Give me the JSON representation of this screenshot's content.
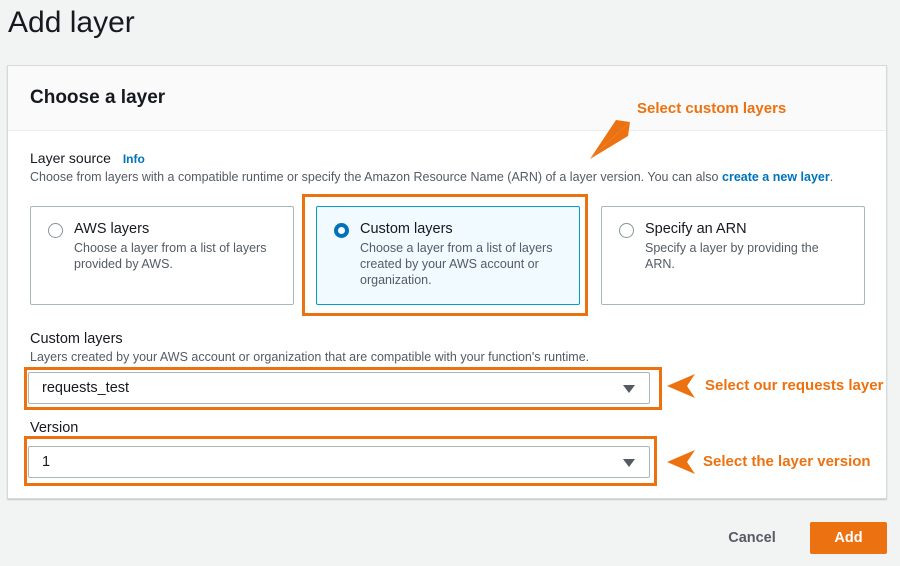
{
  "page": {
    "title": "Add layer"
  },
  "panel": {
    "title": "Choose a layer"
  },
  "layer_source": {
    "label": "Layer source",
    "info_link": "Info",
    "description": "Choose from layers with a compatible runtime or specify the Amazon Resource Name (ARN) of a layer version. You can also",
    "create_link": "create a new layer",
    "description_end": ".",
    "options": [
      {
        "title": "AWS layers",
        "description": "Choose a layer from a list of layers provided by AWS.",
        "selected": false
      },
      {
        "title": "Custom layers",
        "description": "Choose a layer from a list of layers created by your AWS account or organization.",
        "selected": true
      },
      {
        "title": "Specify an ARN",
        "description": "Specify a layer by providing the ARN.",
        "selected": false
      }
    ]
  },
  "custom_layers": {
    "label": "Custom layers",
    "description": "Layers created by your AWS account or organization that are compatible with your function's runtime.",
    "value": "requests_test"
  },
  "version": {
    "label": "Version",
    "value": "1"
  },
  "annotations": {
    "select_custom": "Select custom layers",
    "select_requests": "Select our requests layer",
    "select_version": "Select the layer version"
  },
  "footer": {
    "cancel_label": "Cancel",
    "add_label": "Add"
  },
  "colors": {
    "accent": "#ec7211",
    "link": "#0073bb",
    "selected_tile_border": "#00a1c9"
  }
}
